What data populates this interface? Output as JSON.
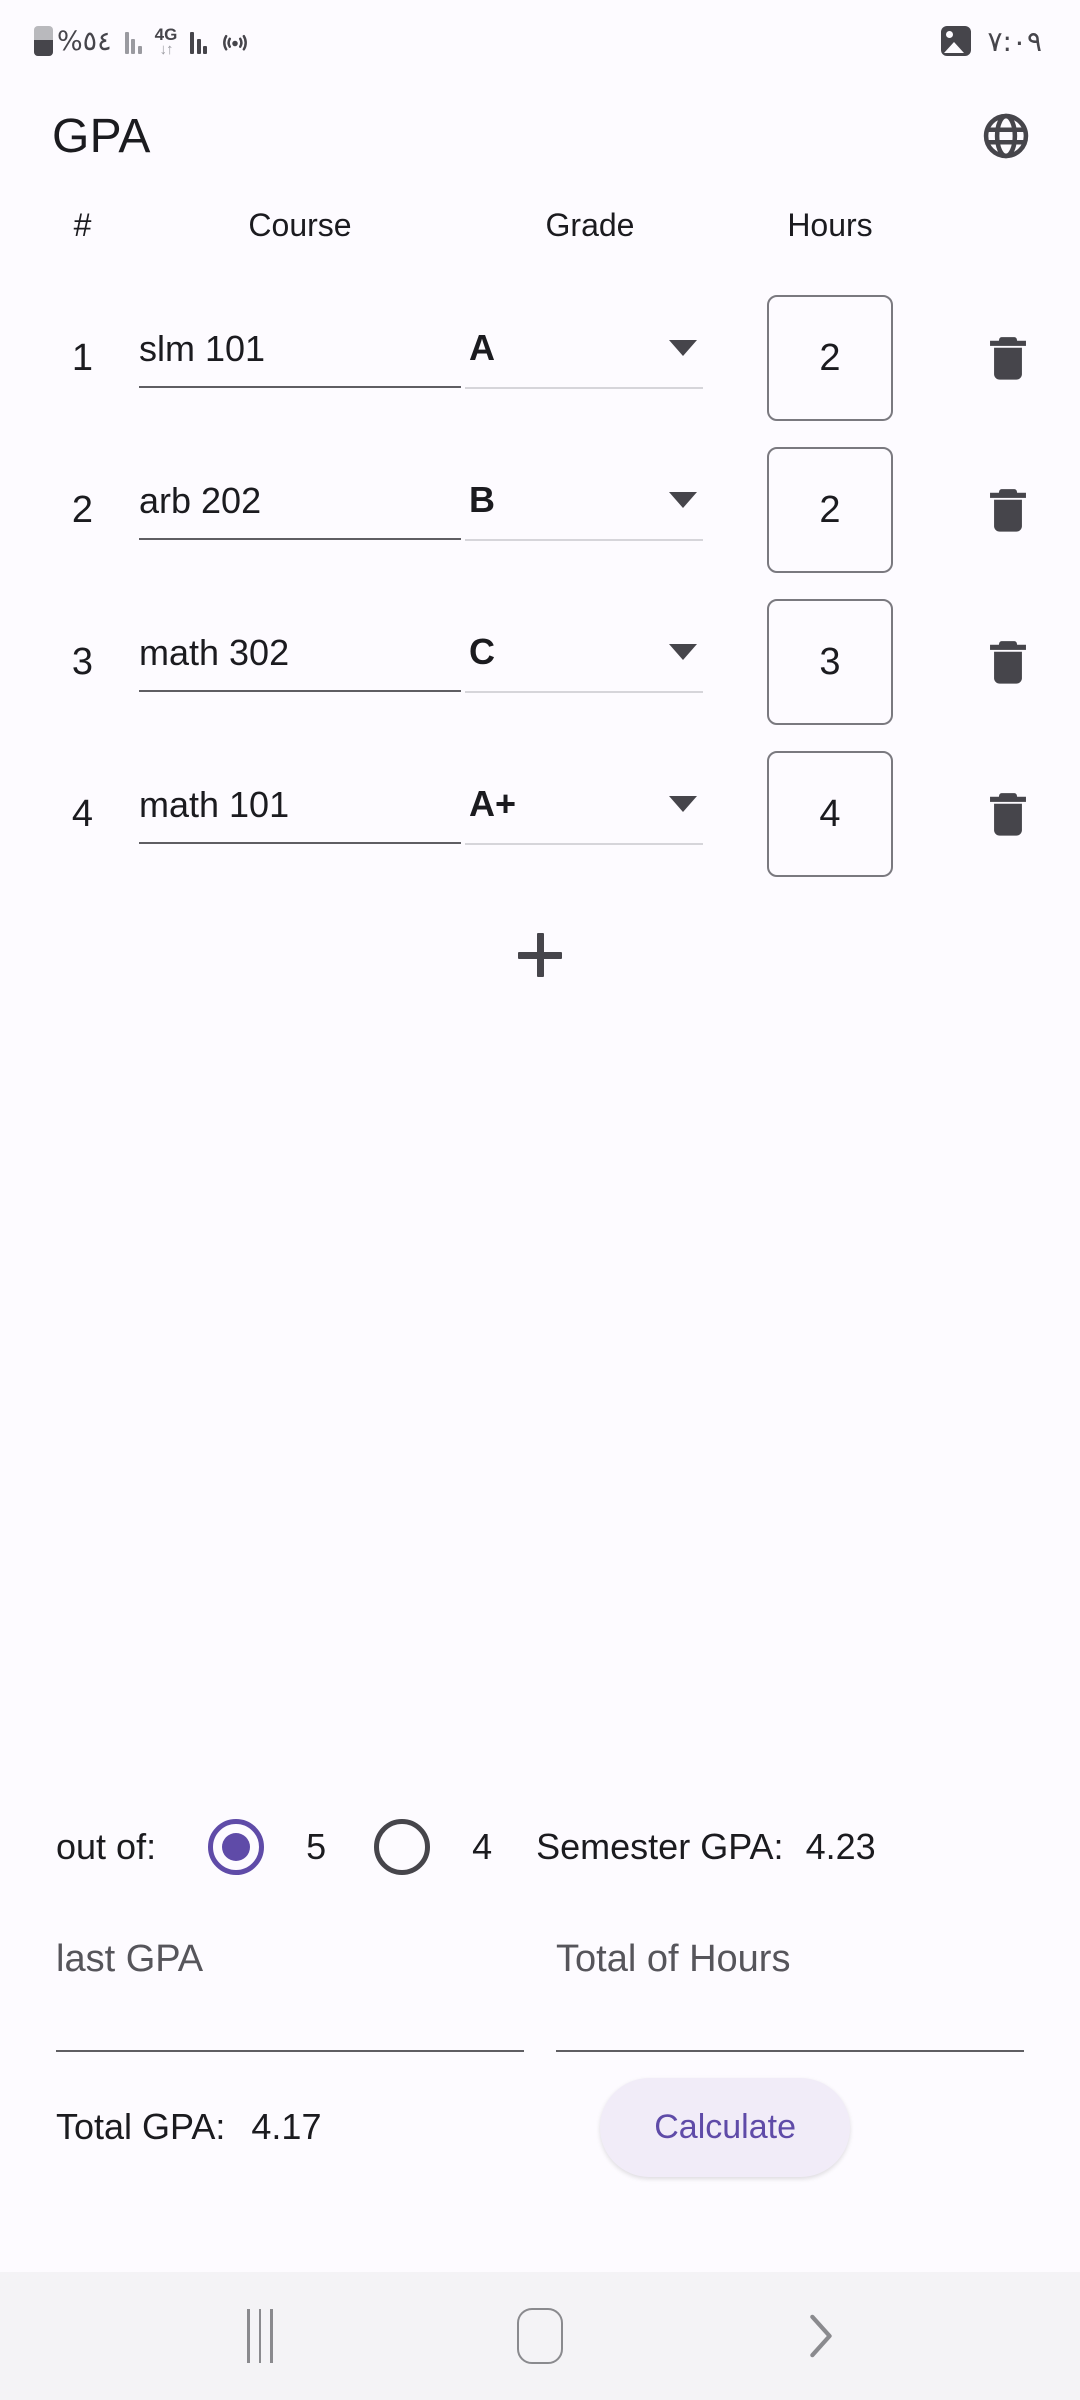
{
  "statusbar": {
    "battery_percent": "%٥٤",
    "network_label": "4G",
    "network_arrows": "↓↑",
    "clock": "٧:٠٩",
    "icons": [
      "battery-icon",
      "signal-bars-icon",
      "4g-network-icon",
      "signal-bars-icon",
      "hotspot-icon",
      "gallery-icon"
    ]
  },
  "appbar": {
    "title": "GPA",
    "language_icon": "globe-icon"
  },
  "table": {
    "headers": {
      "number": "#",
      "course": "Course",
      "grade": "Grade",
      "hours": "Hours"
    },
    "rows": [
      {
        "index": "1",
        "course": "slm 101",
        "grade": "A",
        "hours": "2"
      },
      {
        "index": "2",
        "course": "arb 202",
        "grade": "B",
        "hours": "2"
      },
      {
        "index": "3",
        "course": "math 302",
        "grade": "C",
        "hours": "3"
      },
      {
        "index": "4",
        "course": "math 101",
        "grade": "A+",
        "hours": "4"
      }
    ],
    "add_row_icon": "plus-icon",
    "delete_icon": "trash-icon"
  },
  "scale": {
    "label": "out of:",
    "options": [
      {
        "value": "5",
        "selected": true
      },
      {
        "value": "4",
        "selected": false
      }
    ]
  },
  "semester": {
    "label": "Semester GPA:",
    "value": "4.23"
  },
  "inputs": {
    "last_gpa": {
      "placeholder": "last GPA",
      "value": ""
    },
    "total_hours": {
      "placeholder": "Total of Hours",
      "value": ""
    }
  },
  "total": {
    "label": "Total GPA:",
    "value": "4.17"
  },
  "actions": {
    "calculate_label": "Calculate"
  },
  "navbar": {
    "recents": "recents-icon",
    "home": "home-icon",
    "back": "back-icon"
  },
  "colors": {
    "accent": "#5F4BA8",
    "button_bg": "#F1ECF8",
    "background": "#FDFBFF",
    "text": "#1b1b1f",
    "navbar_bg": "#F4F3F6"
  }
}
